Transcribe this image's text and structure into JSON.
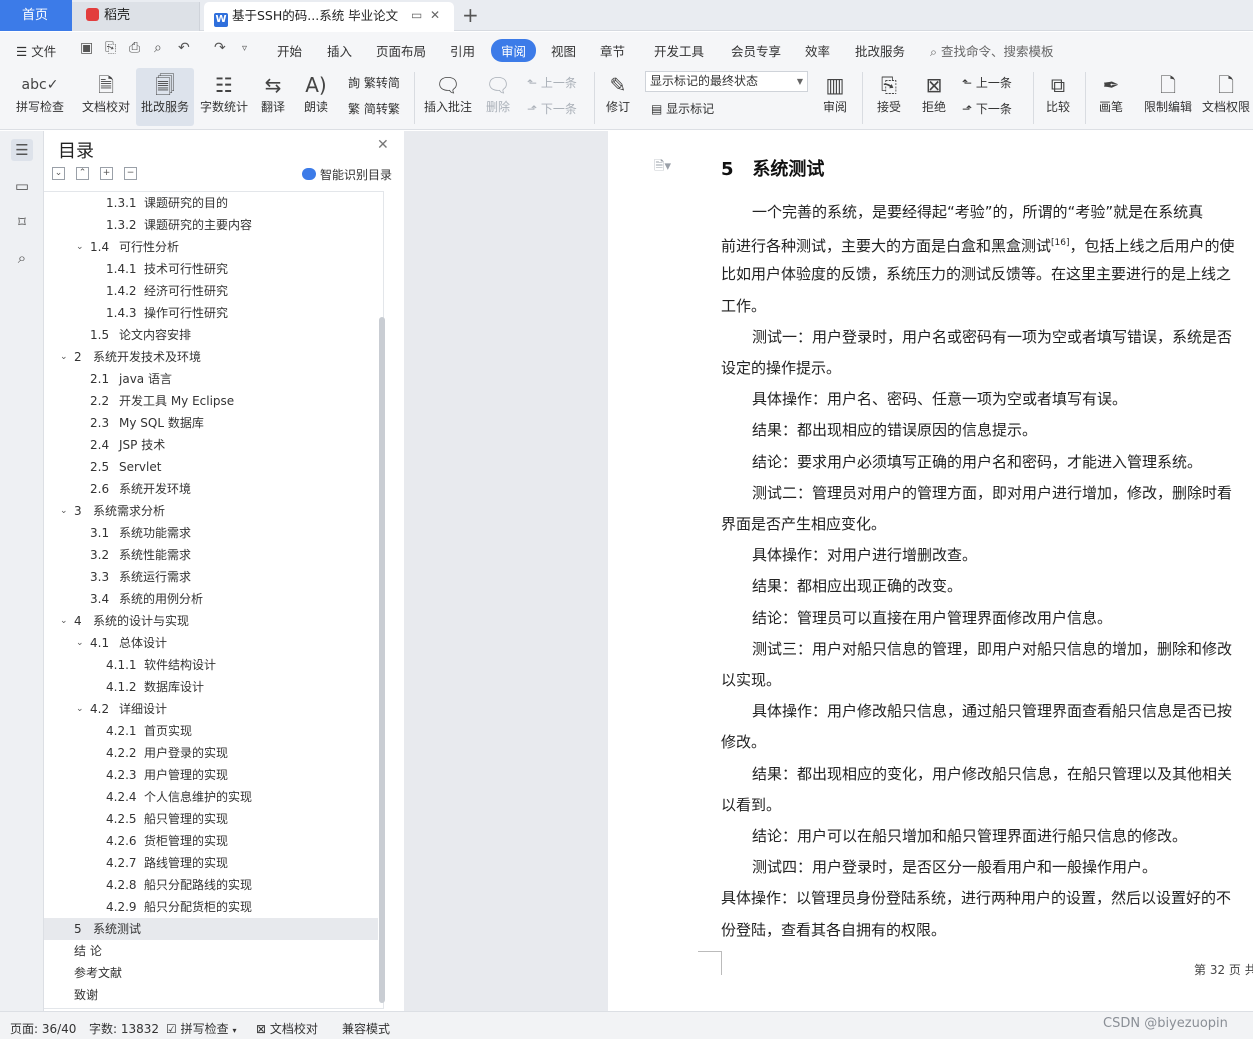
{
  "titlebar": {
    "home_tab": "首页",
    "app_tab": "稻壳",
    "doc_tab": "基于SSH的码...系统 毕业论文",
    "new_tab": "+"
  },
  "menubar": {
    "file": "文件",
    "items": [
      "开始",
      "插入",
      "页面布局",
      "引用",
      "审阅",
      "视图",
      "章节",
      "开发工具",
      "会员专享",
      "效率",
      "批改服务"
    ],
    "active": "审阅",
    "search_placeholder": "查找命令、搜索模板"
  },
  "ribbon": {
    "spell_check": "拼写检查",
    "doc_proof": "文档校对",
    "correction_service": "批改服务",
    "word_count": "字数统计",
    "translate": "翻译",
    "read_aloud": "朗读",
    "trad_to_simp": "繁转简",
    "simp_to_trad": "简转繁",
    "insert_comment": "插入批注",
    "delete": "删除",
    "prev_comment": "上一条",
    "next_comment": "下一条",
    "track_changes": "修订",
    "markup_mode": "显示标记的最终状态",
    "show_markup": "显示标记",
    "review": "审阅",
    "accept": "接受",
    "reject": "拒绝",
    "prev_change": "上一条",
    "next_change": "下一条",
    "compare": "比较",
    "pen": "画笔",
    "restrict_edit": "限制编辑",
    "doc_permission": "文档权限"
  },
  "toc": {
    "title": "目录",
    "smart_detect": "智能识别目录",
    "items": [
      {
        "num": "1.3.1",
        "text": "课题研究的目的",
        "level": 3,
        "arrow": false
      },
      {
        "num": "1.3.2",
        "text": "课题研究的主要内容",
        "level": 3,
        "arrow": false
      },
      {
        "num": "1.4",
        "text": "可行性分析",
        "level": 2,
        "arrow": true
      },
      {
        "num": "1.4.1",
        "text": "技术可行性研究",
        "level": 3,
        "arrow": false
      },
      {
        "num": "1.4.2",
        "text": "经济可行性研究",
        "level": 3,
        "arrow": false
      },
      {
        "num": "1.4.3",
        "text": "操作可行性研究",
        "level": 3,
        "arrow": false
      },
      {
        "num": "1.5",
        "text": "论文内容安排",
        "level": 2,
        "arrow": false
      },
      {
        "num": "2",
        "text": "系统开发技术及环境",
        "level": 1,
        "arrow": true
      },
      {
        "num": "2.1",
        "text": "java 语言",
        "level": 2,
        "arrow": false
      },
      {
        "num": "2.2",
        "text": "开发工具 My Eclipse",
        "level": 2,
        "arrow": false
      },
      {
        "num": "2.3",
        "text": "My SQL 数据库",
        "level": 2,
        "arrow": false
      },
      {
        "num": "2.4",
        "text": "JSP 技术",
        "level": 2,
        "arrow": false
      },
      {
        "num": "2.5",
        "text": "Servlet",
        "level": 2,
        "arrow": false
      },
      {
        "num": "2.6",
        "text": "系统开发环境",
        "level": 2,
        "arrow": false
      },
      {
        "num": "3",
        "text": "系统需求分析",
        "level": 1,
        "arrow": true
      },
      {
        "num": "3.1",
        "text": "系统功能需求",
        "level": 2,
        "arrow": false
      },
      {
        "num": "3.2",
        "text": "系统性能需求",
        "level": 2,
        "arrow": false
      },
      {
        "num": "3.3",
        "text": "系统运行需求",
        "level": 2,
        "arrow": false
      },
      {
        "num": "3.4",
        "text": "系统的用例分析",
        "level": 2,
        "arrow": false
      },
      {
        "num": "4",
        "text": "系统的设计与实现",
        "level": 1,
        "arrow": true
      },
      {
        "num": "4.1",
        "text": "总体设计",
        "level": 2,
        "arrow": true
      },
      {
        "num": "4.1.1",
        "text": "软件结构设计",
        "level": 3,
        "arrow": false
      },
      {
        "num": "4.1.2",
        "text": "数据库设计",
        "level": 3,
        "arrow": false
      },
      {
        "num": "4.2",
        "text": "详细设计",
        "level": 2,
        "arrow": true
      },
      {
        "num": "4.2.1",
        "text": "首页实现",
        "level": 3,
        "arrow": false
      },
      {
        "num": "4.2.2",
        "text": "用户登录的实现",
        "level": 3,
        "arrow": false
      },
      {
        "num": "4.2.3",
        "text": "用户管理的实现",
        "level": 3,
        "arrow": false
      },
      {
        "num": "4.2.4",
        "text": "个人信息维护的实现",
        "level": 3,
        "arrow": false
      },
      {
        "num": "4.2.5",
        "text": "船只管理的实现",
        "level": 3,
        "arrow": false
      },
      {
        "num": "4.2.6",
        "text": "货柜管理的实现",
        "level": 3,
        "arrow": false
      },
      {
        "num": "4.2.7",
        "text": "路线管理的实现",
        "level": 3,
        "arrow": false
      },
      {
        "num": "4.2.8",
        "text": "船只分配路线的实现",
        "level": 3,
        "arrow": false
      },
      {
        "num": "4.2.9",
        "text": "船只分配货柜的实现",
        "level": 3,
        "arrow": false
      },
      {
        "num": "5",
        "text": "系统测试",
        "level": 1,
        "arrow": false,
        "selected": true
      },
      {
        "num": "",
        "text": "结 论",
        "level": 1,
        "arrow": false
      },
      {
        "num": "",
        "text": "参考文献",
        "level": 1,
        "arrow": false
      },
      {
        "num": "",
        "text": "致谢",
        "level": 1,
        "arrow": false
      }
    ]
  },
  "document": {
    "heading_num": "5",
    "heading_text": "系统测试",
    "lines": [
      {
        "text": "一个完善的系统，是要经得起“考验”的，所谓的“考验”就是在系统真",
        "indent": true
      },
      {
        "text": "前进行各种测试，主要大的方面是白盒和黑盒测试",
        "indent": false,
        "cite": "[16]",
        "after": "，包括上线之后用户的使"
      },
      {
        "text": "比如用户体验度的反馈，系统压力的测试反馈等。在这里主要进行的是上线之",
        "indent": false
      },
      {
        "text": "工作。",
        "indent": false
      },
      {
        "text": "测试一：用户登录时，用户名或密码有一项为空或者填写错误，系统是否",
        "indent": true
      },
      {
        "text": "设定的操作提示。",
        "indent": false
      },
      {
        "text": "具体操作：用户名、密码、任意一项为空或者填写有误。",
        "indent": true
      },
      {
        "text": "结果：都出现相应的错误原因的信息提示。",
        "indent": true
      },
      {
        "text": "结论：要求用户必须填写正确的用户名和密码，才能进入管理系统。",
        "indent": true
      },
      {
        "text": "测试二：管理员对用户的管理方面，即对用户进行增加，修改，删除时看",
        "indent": true
      },
      {
        "text": "界面是否产生相应变化。",
        "indent": false
      },
      {
        "text": "具体操作：对用户进行增删改查。",
        "indent": true
      },
      {
        "text": "结果：都相应出现正确的改变。",
        "indent": true
      },
      {
        "text": "结论：管理员可以直接在用户管理界面修改用户信息。",
        "indent": true
      },
      {
        "text": "测试三：用户对船只信息的管理，即用户对船只信息的增加，删除和修改",
        "indent": true
      },
      {
        "text": "以实现。",
        "indent": false
      },
      {
        "text": "具体操作：用户修改船只信息，通过船只管理界面查看船只信息是否已按",
        "indent": true
      },
      {
        "text": "修改。",
        "indent": false
      },
      {
        "text": "结果：都出现相应的变化，用户修改船只信息，在船只管理以及其他相关",
        "indent": true
      },
      {
        "text": "以看到。",
        "indent": false
      },
      {
        "text": "结论：用户可以在船只增加和船只管理界面进行船只信息的修改。",
        "indent": true
      },
      {
        "text": "测试四：用户登录时，是否区分一般看用户和一般操作用户。",
        "indent": true
      },
      {
        "text": "具体操作：以管理员身份登陆系统，进行两种用户的设置，然后以设置好的不",
        "indent": false
      },
      {
        "text": "份登陆，查看其各自拥有的权限。",
        "indent": false
      }
    ],
    "page_footer": "第 32 页 共"
  },
  "statusbar": {
    "page": "页面: 36/40",
    "word_count": "字数: 13832",
    "spell_check": "拼写检查",
    "doc_proof": "文档校对",
    "compat_mode": "兼容模式",
    "watermark": "CSDN @biyezuopin"
  }
}
